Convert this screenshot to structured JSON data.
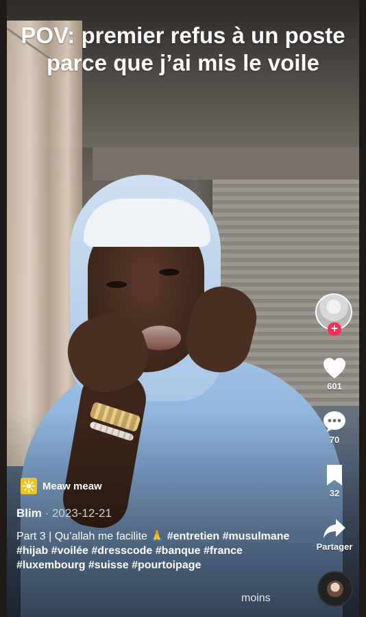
{
  "video": {
    "caption": "POV: premier refus à un poste parce que j’ai mis le voile"
  },
  "rail": {
    "follow_symbol": "+",
    "likes": "601",
    "comments": "70",
    "saves": "32",
    "share_label": "Partager",
    "like_icon": "heart-icon",
    "comment_icon": "comment-bubble-icon",
    "save_icon": "bookmark-icon",
    "share_icon": "share-arrow-icon"
  },
  "sound": {
    "label": "Meaw meaw",
    "icon": "sparkle-tag-icon",
    "accent": "#f0c419"
  },
  "post": {
    "author": "Blim",
    "separator": " · ",
    "date": "2023-12-21",
    "text_prefix": "Part 3 | Qu’allah me facilite 🙏 ",
    "hashtags": "#entretien #musulmane #hijab #voilée #dresscode #banque #france #luxembourg #suisse #pourtoipage",
    "less_label": "moins"
  },
  "colors": {
    "follow": "#fe2c55",
    "text": "#ffffff"
  }
}
